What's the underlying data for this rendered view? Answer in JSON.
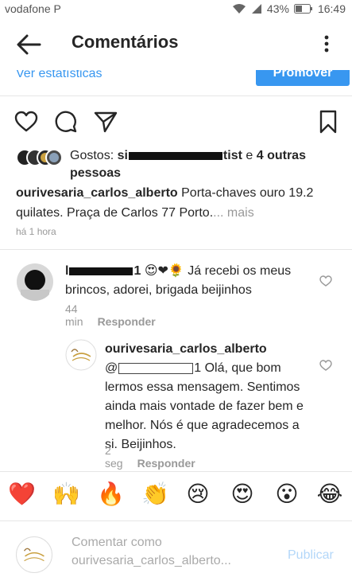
{
  "status": {
    "carrier": "vodafone P",
    "battery": "43%",
    "time": "16:49"
  },
  "header": {
    "title": "Comentários"
  },
  "stats": {
    "link_label": "Ver estatísticas",
    "promote_label": "Promover"
  },
  "likes": {
    "prefix": "Gostos: ",
    "partial_name": "si",
    "partial_name_end": "tist",
    "connector": " e ",
    "others": "4 outras pessoas"
  },
  "post": {
    "author": "ourivesaria_carlos_alberto",
    "caption": " Porta-chaves ouro 19.2 quilates. Praça de Carlos 77 Porto.",
    "more": "... mais",
    "time": "há 1 hora"
  },
  "comments": [
    {
      "user_start": "l",
      "user_end": "1",
      "emojis": "😍❤🌻",
      "text": " Já recebi os meus brincos, adorei, brigada beijinhos",
      "time": "44 min",
      "reply": "Responder"
    },
    {
      "user": "ourivesaria_carlos_alberto",
      "mention_start": "@",
      "mention_end": "1",
      "text": " Olá, que bom lermos essa mensagem. Sentimos ainda mais vontade de fazer bem e melhor. Nós é que agradecemos a si. Beijinhos.",
      "time": "2 seg",
      "reply": "Responder"
    }
  ],
  "emoji_bar": [
    "❤️",
    "🙌",
    "🔥",
    "👏",
    "😢",
    "😍",
    "😮",
    "😂"
  ],
  "composer": {
    "placeholder": "Comentar como ourivesaria_carlos_alberto...",
    "publish": "Publicar"
  },
  "colors": {
    "link": "#3897f0",
    "text": "#262626",
    "muted": "#999999"
  }
}
